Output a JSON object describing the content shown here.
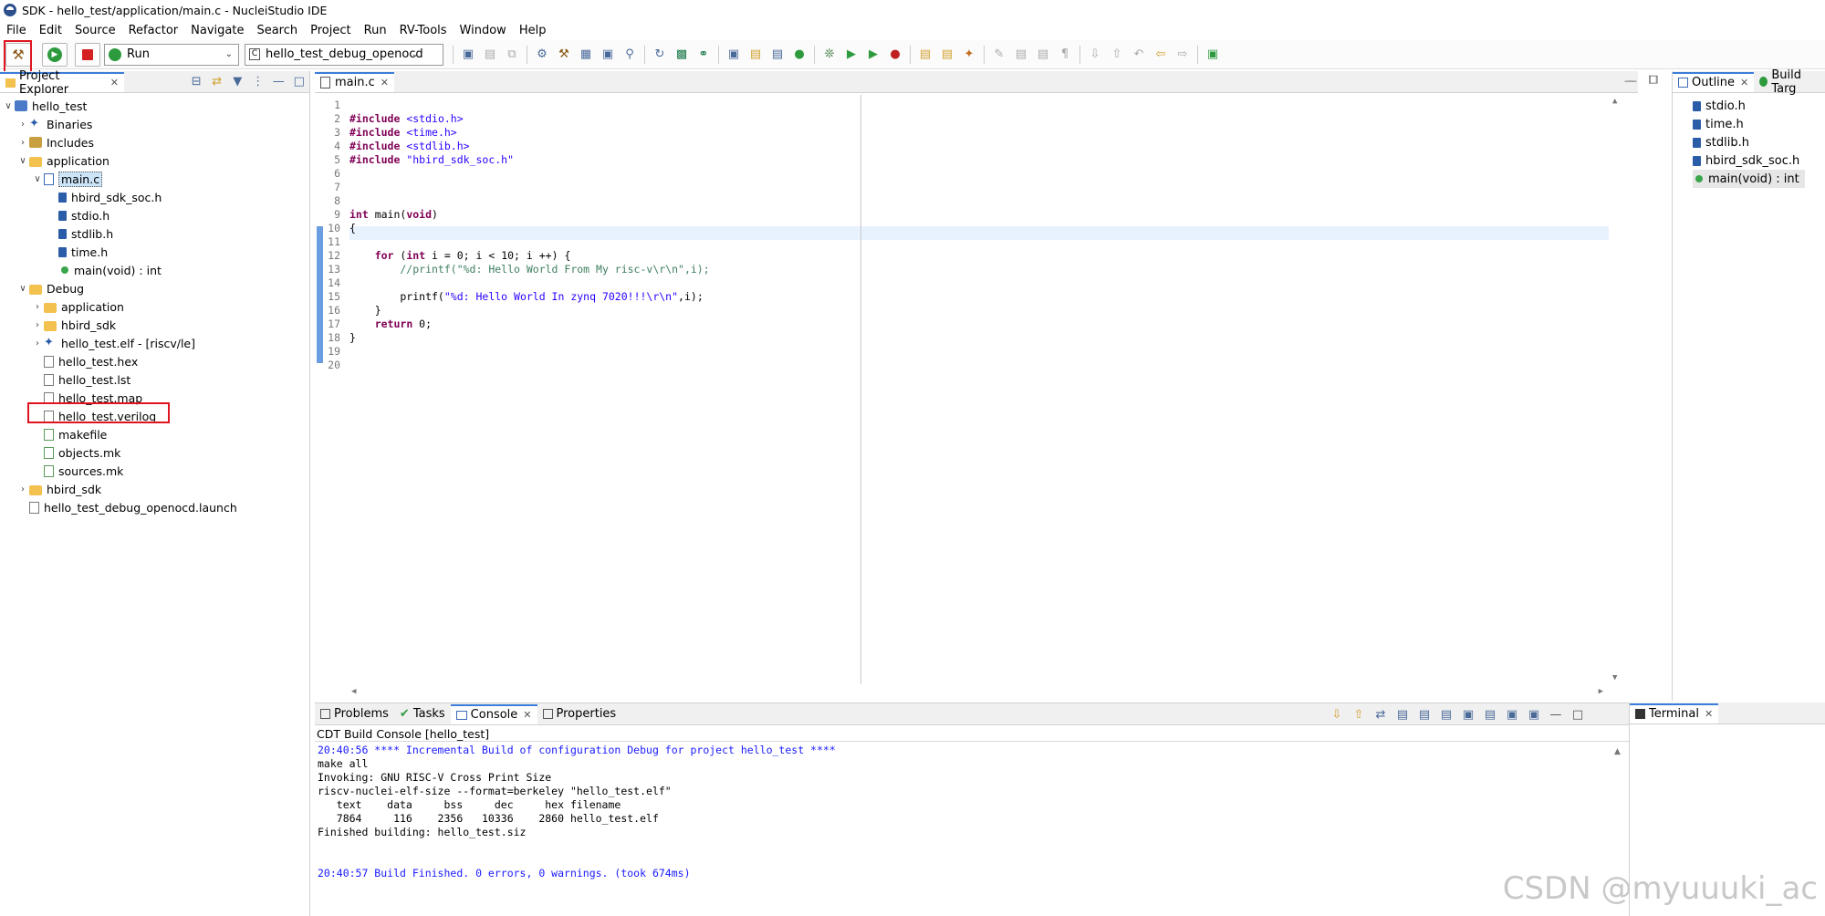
{
  "window": {
    "title": "SDK - hello_test/application/main.c - NucleiStudio IDE"
  },
  "menu": [
    "File",
    "Edit",
    "Source",
    "Refactor",
    "Navigate",
    "Search",
    "Project",
    "Run",
    "RV-Tools",
    "Window",
    "Help"
  ],
  "toolbar": {
    "run_mode": "Run",
    "launch_config": "hello_test_debug_openocd"
  },
  "project_explorer": {
    "tab_label": "Project Explorer",
    "tree": [
      {
        "label": "hello_test",
        "depth": 0,
        "chev": "v",
        "icon": "project"
      },
      {
        "label": "Binaries",
        "depth": 1,
        "chev": ">",
        "icon": "binaries"
      },
      {
        "label": "Includes",
        "depth": 1,
        "chev": ">",
        "icon": "includes"
      },
      {
        "label": "application",
        "depth": 1,
        "chev": "v",
        "icon": "folder"
      },
      {
        "label": "main.c",
        "depth": 2,
        "chev": "v",
        "icon": "cfile",
        "selected": true
      },
      {
        "label": "hbird_sdk_soc.h",
        "depth": 3,
        "chev": "",
        "icon": "header"
      },
      {
        "label": "stdio.h",
        "depth": 3,
        "chev": "",
        "icon": "header"
      },
      {
        "label": "stdlib.h",
        "depth": 3,
        "chev": "",
        "icon": "header"
      },
      {
        "label": "time.h",
        "depth": 3,
        "chev": "",
        "icon": "header"
      },
      {
        "label": "main(void) : int",
        "depth": 3,
        "chev": "",
        "icon": "function"
      },
      {
        "label": "Debug",
        "depth": 1,
        "chev": "v",
        "icon": "folder"
      },
      {
        "label": "application",
        "depth": 2,
        "chev": ">",
        "icon": "folder"
      },
      {
        "label": "hbird_sdk",
        "depth": 2,
        "chev": ">",
        "icon": "folder"
      },
      {
        "label": "hello_test.elf - [riscv/le]",
        "depth": 2,
        "chev": ">",
        "icon": "elf"
      },
      {
        "label": "hello_test.hex",
        "depth": 2,
        "chev": "",
        "icon": "file"
      },
      {
        "label": "hello_test.lst",
        "depth": 2,
        "chev": "",
        "icon": "file"
      },
      {
        "label": "hello_test.map",
        "depth": 2,
        "chev": "",
        "icon": "file"
      },
      {
        "label": "hello_test.verilog",
        "depth": 2,
        "chev": "",
        "icon": "file",
        "highlighted": true
      },
      {
        "label": "makefile",
        "depth": 2,
        "chev": "",
        "icon": "makefile"
      },
      {
        "label": "objects.mk",
        "depth": 2,
        "chev": "",
        "icon": "makefile"
      },
      {
        "label": "sources.mk",
        "depth": 2,
        "chev": "",
        "icon": "makefile"
      },
      {
        "label": "hbird_sdk",
        "depth": 1,
        "chev": ">",
        "icon": "folder"
      },
      {
        "label": "hello_test_debug_openocd.launch",
        "depth": 1,
        "chev": "",
        "icon": "file"
      }
    ]
  },
  "editor": {
    "tab_label": "main.c",
    "lines": [
      {
        "n": "1",
        "t": ""
      },
      {
        "n": "2",
        "t": "#include <stdio.h>"
      },
      {
        "n": "3",
        "t": "#include <time.h>"
      },
      {
        "n": "4",
        "t": "#include <stdlib.h>"
      },
      {
        "n": "5",
        "t": "#include \"hbird_sdk_soc.h\""
      },
      {
        "n": "6",
        "t": ""
      },
      {
        "n": "7",
        "t": ""
      },
      {
        "n": "8",
        "t": ""
      },
      {
        "n": "9",
        "t": "int main(void)"
      },
      {
        "n": "10",
        "t": "{"
      },
      {
        "n": "11",
        "t": ""
      },
      {
        "n": "12",
        "t": "    for (int i = 0; i < 10; i ++) {"
      },
      {
        "n": "13",
        "t": "        //printf(\"%d: Hello World From My risc-v\\r\\n\",i);"
      },
      {
        "n": "14",
        "t": ""
      },
      {
        "n": "15",
        "t": "        printf(\"%d: Hello World In zynq 7020!!!\\r\\n\",i);"
      },
      {
        "n": "16",
        "t": "    }"
      },
      {
        "n": "17",
        "t": "    return 0;"
      },
      {
        "n": "18",
        "t": "}"
      },
      {
        "n": "19",
        "t": ""
      },
      {
        "n": "20",
        "t": ""
      }
    ]
  },
  "outline": {
    "tab_label": "Outline",
    "tab2_label": "Build Targ",
    "items": [
      "stdio.h",
      "time.h",
      "stdlib.h",
      "hbird_sdk_soc.h",
      "main(void) : int"
    ]
  },
  "console_panel": {
    "tabs": [
      "Problems",
      "Tasks",
      "Console",
      "Properties"
    ],
    "title": "CDT Build Console [hello_test]",
    "lines": [
      {
        "t": "20:40:56 **** Incremental Build of configuration Debug for project hello_test ****",
        "blue": true
      },
      {
        "t": "make all",
        "blue": false
      },
      {
        "t": "Invoking: GNU RISC-V Cross Print Size",
        "blue": false
      },
      {
        "t": "riscv-nuclei-elf-size --format=berkeley \"hello_test.elf\"",
        "blue": false
      },
      {
        "t": "   text    data     bss     dec     hex filename",
        "blue": false
      },
      {
        "t": "   7864     116    2356   10336    2860 hello_test.elf",
        "blue": false
      },
      {
        "t": "Finished building: hello_test.siz",
        "blue": false
      },
      {
        "t": "",
        "blue": false
      },
      {
        "t": "",
        "blue": false
      },
      {
        "t": "20:40:57 Build Finished. 0 errors, 0 warnings. (took 674ms)",
        "blue": true
      }
    ]
  },
  "terminal": {
    "tab_label": "Terminal"
  },
  "watermark": "CSDN @myuuuki_ac"
}
